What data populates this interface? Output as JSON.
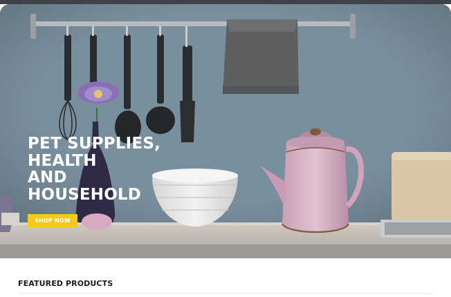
{
  "hero": {
    "title_lines": [
      "PET SUPPLIES,",
      "HEALTH",
      "AND",
      "HOUSEHOLD"
    ],
    "cta_label": "SHOP NOW"
  },
  "sections": {
    "featured_title": "FEATURED PRODUCTS"
  },
  "colors": {
    "cta": "#f4c91a",
    "hero_text": "#ffffff",
    "heading": "#1d1d1d"
  }
}
